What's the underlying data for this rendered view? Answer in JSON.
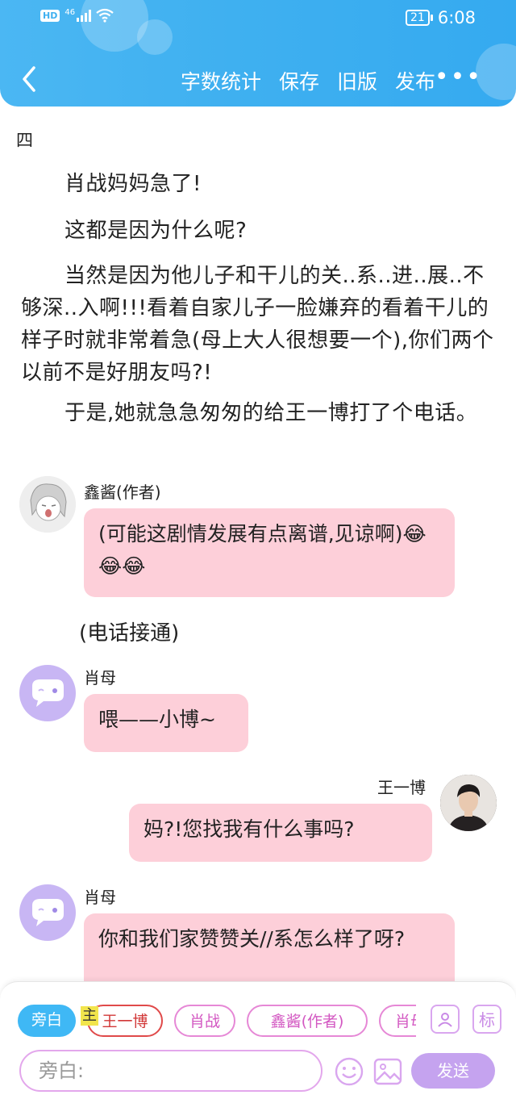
{
  "status_bar": {
    "network": "46",
    "battery": "21",
    "time": "6:08",
    "hd": "HD"
  },
  "nav": {
    "items": [
      "字数统计",
      "保存",
      "旧版",
      "发布"
    ],
    "more": "•••"
  },
  "chapter": {
    "title": "四"
  },
  "paragraphs": [
    "肖战妈妈急了!",
    "这都是因为什么呢?",
    "当然是因为他儿子和干儿的关..系..进..展..不够深..入啊!!!看着自家儿子一脸嫌弃的看着干儿的样子时就非常着急(母上大人很想要一个),你们两个以前不是好朋友吗?!",
    "于是,她就急急匆匆的给王一博打了个电话。"
  ],
  "messages": [
    {
      "speaker": "鑫酱(作者)",
      "text": "(可能这剧情发展有点离谱,见谅啊)😂😂😂"
    },
    {
      "narration": "(电话接通)"
    },
    {
      "speaker": "肖母",
      "text": "喂——小博~"
    },
    {
      "speaker": "王一博",
      "text": "妈?!您找我有什么事吗?"
    },
    {
      "speaker": "肖母",
      "text": "你和我们家赞赞关//系怎么样了呀?"
    }
  ],
  "composer": {
    "role_chips": [
      "旁白",
      "王一博",
      "肖战",
      "鑫酱(作者)",
      "肖母"
    ],
    "main_tag": "主",
    "tag_button": "标",
    "input_placeholder": "旁白:",
    "send_label": "发送"
  },
  "colors": {
    "header": "#3fb0f0",
    "bubble": "#fdcfd9",
    "chip_outline": "#e688d6",
    "send": "#c5a3ef"
  }
}
